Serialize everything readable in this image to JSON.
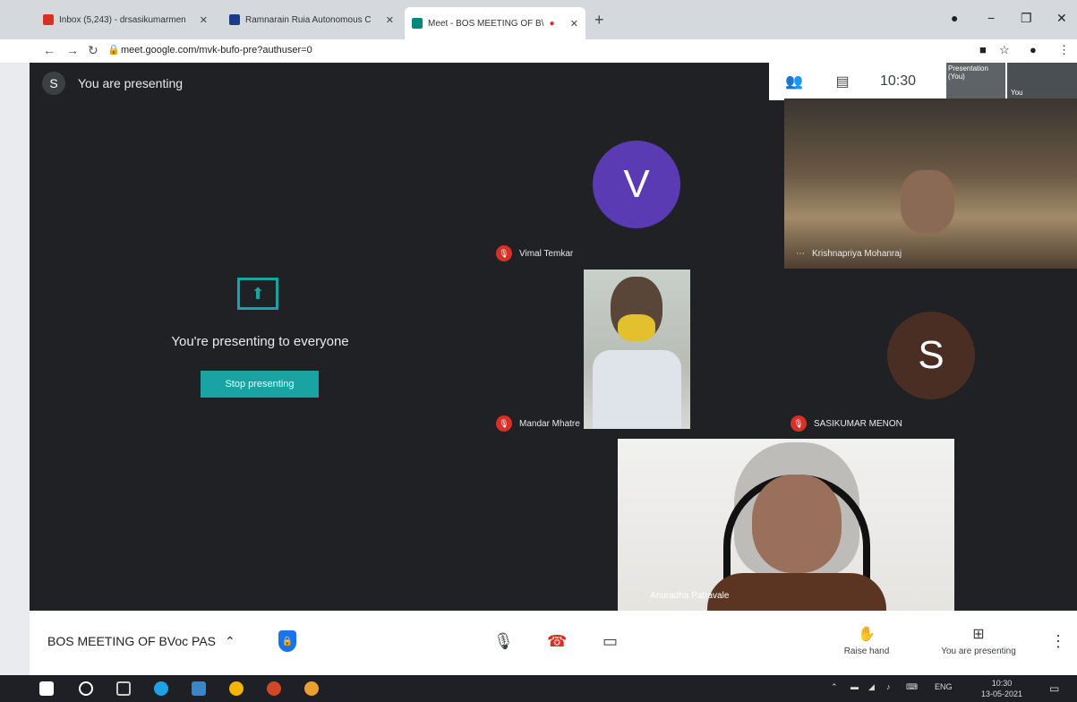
{
  "browser": {
    "tabs": [
      {
        "label": "Inbox (5,243) - drsasikumarmen",
        "favicon_color": "#d93025"
      },
      {
        "label": "Ramnarain Ruia Autonomous C",
        "favicon_color": "#1a3c8a"
      },
      {
        "label": "Meet - BOS MEETING OF B\\",
        "favicon_color": "#00897b"
      }
    ],
    "url": "meet.google.com/mvk-bufo-pre?authuser=0"
  },
  "meet": {
    "banner": {
      "avatar_letter": "S",
      "text": "You are presenting"
    },
    "top_bar": {
      "time": "10:30",
      "self_tiles": [
        {
          "label": "Presentation (You)"
        },
        {
          "label": "You"
        }
      ]
    },
    "presenting": {
      "title": "You're presenting to everyone",
      "stop_label": "Stop presenting"
    },
    "participants": [
      {
        "name": "Vimal Temkar",
        "avatar_letter": "V",
        "avatar_color": "#5b3bb4",
        "muted": true
      },
      {
        "name": "Krishnapriya Mohanraj",
        "video": true,
        "muted": false
      },
      {
        "name": "Mandar Mhatre",
        "video": true,
        "muted": true
      },
      {
        "name": "SASIKUMAR MENON",
        "avatar_letter": "S",
        "avatar_color": "#4a2e24",
        "muted": true
      },
      {
        "name": "Anuradha Patravale",
        "video": true,
        "muted": false
      }
    ],
    "bottom_bar": {
      "meeting_title": "BOS MEETING OF BVoc PAS",
      "raise_hand_label": "Raise hand",
      "presenting_label": "You are presenting"
    }
  },
  "taskbar": {
    "language": "ENG",
    "time": "10:30",
    "date": "13-05-2021"
  }
}
